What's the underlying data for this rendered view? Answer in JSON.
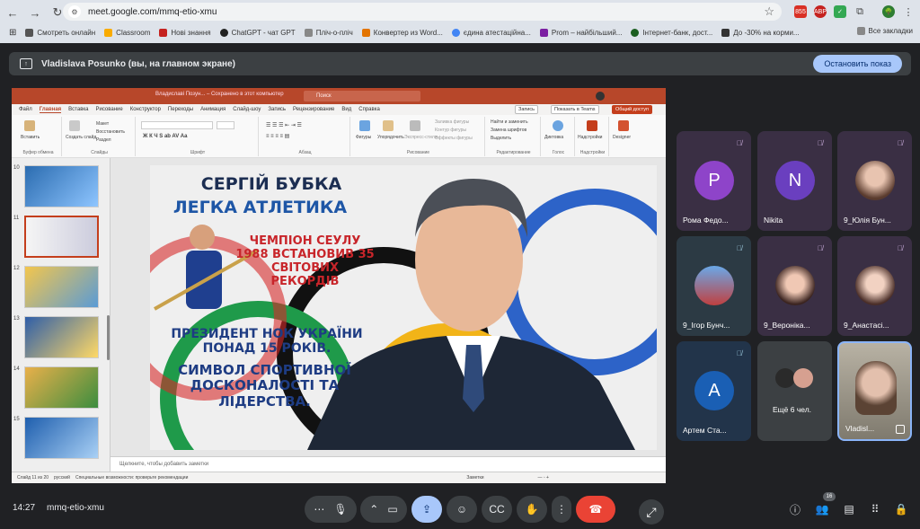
{
  "browser": {
    "url": "meet.google.com/mmq-etio-xmu",
    "bookmarks": [
      "Смотреть онлайн",
      "Classroom",
      "Нові знання",
      "ChatGPT - чат GPT",
      "Пліч-о-пліч",
      "Конвертер из Word...",
      "єдина атестаційна...",
      "Prom – найбільший...",
      "Інтернет-банк, дост...",
      "До -30% на корми..."
    ],
    "all_bookmarks": "Все закладки",
    "ext_badge": "855",
    "ext_abp": "ABP"
  },
  "meet": {
    "presenting_label": "Vladislava Posunko (вы, на главном экране)",
    "stop_button": "Остановить показ",
    "time": "14:27",
    "meeting_code": "mmq-etio-xmu",
    "participant_count": "16",
    "participants": [
      {
        "name": "Рома Федо...",
        "initial": "P",
        "color": "#8e44c9"
      },
      {
        "name": "Nikita",
        "initial": "N",
        "color": "#6a3fbf"
      },
      {
        "name": "9_Юлія Бун..."
      },
      {
        "name": "9_Ігор Бунч..."
      },
      {
        "name": "9_Вероніка..."
      },
      {
        "name": "9_Анастасі..."
      },
      {
        "name": "Артем Ста...",
        "initial": "A",
        "color": "#1a5fb4"
      },
      {
        "name": "Ещё 6 чел."
      },
      {
        "name": "Vladisl..."
      }
    ]
  },
  "powerpoint": {
    "title": "Владиславі Позун... – Сохранено в этот компьютер",
    "search": "Поиск",
    "menu": [
      "Файл",
      "Главная",
      "Вставка",
      "Рисование",
      "Конструктор",
      "Переходы",
      "Анимация",
      "Слайд-шоу",
      "Запись",
      "Рецензирование",
      "Вид",
      "Справка"
    ],
    "menu_buttons": {
      "record": "Запись",
      "present": "Показать в Teams",
      "share": "Общий доступ"
    },
    "ribbon": {
      "groups": [
        "Буфер обмена",
        "Слайды",
        "Шрифт",
        "Абзац",
        "Рисование",
        "Редактирование",
        "Голос",
        "Надстройки"
      ],
      "paste": "Вставить",
      "new_slide": "Создать слайд",
      "layout": "Макет",
      "reset": "Восстановить",
      "section": "Раздел",
      "shapes": "Фигуры",
      "arrange": "Упорядочить",
      "quick_styles": "Экспресс-стили",
      "shape_fill": "Заливка фигуры",
      "shape_outline": "Контур фигуры",
      "shape_effects": "Эффекты фигуры",
      "find": "Найти и заменить",
      "replace_fonts": "Замена шрифтов",
      "select": "Выделить",
      "dictate": "Диктовка",
      "addins": "Надстройки",
      "designer": "Designer"
    },
    "slide_numbers": [
      "10",
      "11",
      "12",
      "13",
      "14",
      "15"
    ],
    "notes_placeholder": "Щелкните, чтобы добавить заметки",
    "status": {
      "slide": "Слайд 11 из 20",
      "lang": "русский",
      "accessibility": "Специальные возможности: проверьте рекомендации",
      "notes": "Заметки"
    },
    "slide": {
      "title": "СЕРГІЙ БУБКА",
      "subtitle": "ЛЕГКА АТЛЕТИКА",
      "red_text": "ЧЕМПІОН СЕУЛУ 1988 ВСТАНОВИВ 35 СВІТОВИХ РЕКОРДІВ",
      "blue_text1": "ПРЕЗИДЕНТ НОК УКРАЇНИ ПОНАД 15 РОКІВ.",
      "blue_text2": "СИМВОЛ СПОРТИВНОЇ ДОСКОНАЛОСТІ ТА ЛІДЕРСТВА."
    }
  }
}
